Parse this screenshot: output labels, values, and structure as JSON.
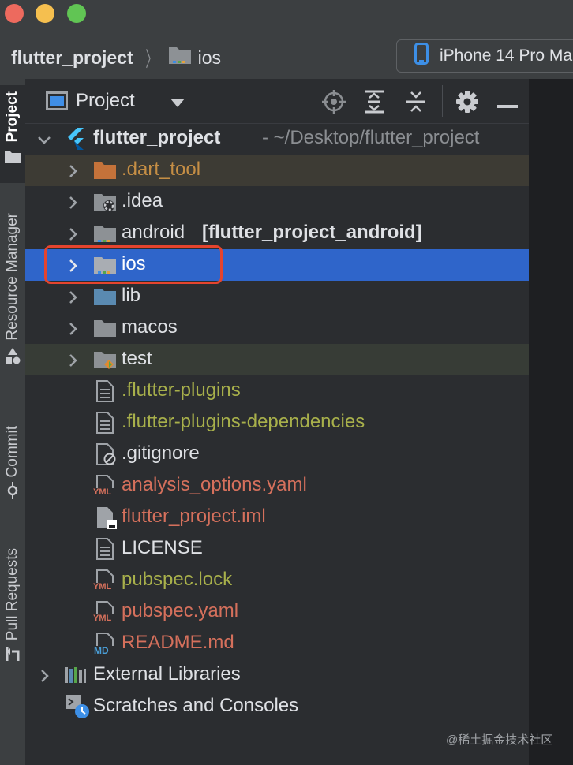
{
  "window": {
    "traffic_lights": [
      "close",
      "minimize",
      "maximize"
    ]
  },
  "breadcrumb": {
    "root": "flutter_project",
    "current": "ios"
  },
  "device_selector": {
    "label": "iPhone 14 Pro Ma"
  },
  "left_stripe": {
    "tabs": [
      {
        "label": "Project",
        "active": true
      },
      {
        "label": "Resource Manager",
        "active": false
      },
      {
        "label": "Commit",
        "active": false
      },
      {
        "label": "Pull Requests",
        "active": false
      }
    ]
  },
  "project_panel": {
    "title": "Project",
    "view_dropdown_icon": "triangle-down-icon",
    "toolbar_icons": [
      "locate-icon",
      "expand-all-icon",
      "collapse-all-icon",
      "gear-icon",
      "hide-icon"
    ]
  },
  "tree": {
    "root": {
      "name": "flutter_project",
      "path": "- ~/Desktop/flutter_project"
    },
    "items": [
      {
        "name": ".dart_tool",
        "type": "folder-orange",
        "color": "#c58e45"
      },
      {
        "name": ".idea",
        "type": "folder-settings",
        "color": "#dfe1e5"
      },
      {
        "name": "android",
        "suffix": "[flutter_project_android]",
        "type": "folder-module",
        "color": "#dfe1e5"
      },
      {
        "name": "ios",
        "type": "folder-module",
        "color": "#ffffff",
        "selected": true
      },
      {
        "name": "lib",
        "type": "folder-source",
        "color": "#dfe1e5"
      },
      {
        "name": "macos",
        "type": "folder",
        "color": "#dfe1e5"
      },
      {
        "name": "test",
        "type": "folder-test",
        "color": "#dfe1e5"
      },
      {
        "name": ".flutter-plugins",
        "type": "file-text",
        "color": "#a8b04b"
      },
      {
        "name": ".flutter-plugins-dependencies",
        "type": "file-text",
        "color": "#a8b04b"
      },
      {
        "name": ".gitignore",
        "type": "file-ignore",
        "color": "#dfe1e5"
      },
      {
        "name": "analysis_options.yaml",
        "type": "file-yaml",
        "color": "#d5705c"
      },
      {
        "name": "flutter_project.iml",
        "type": "file-iml",
        "color": "#d5705c"
      },
      {
        "name": "LICENSE",
        "type": "file-text",
        "color": "#dfe1e5"
      },
      {
        "name": "pubspec.lock",
        "type": "file-yaml",
        "color": "#a8b04b"
      },
      {
        "name": "pubspec.yaml",
        "type": "file-yaml",
        "color": "#d5705c"
      },
      {
        "name": "README.md",
        "type": "file-md",
        "color": "#d5705c"
      }
    ],
    "external_libraries": "External Libraries",
    "scratches": "Scratches and Consoles"
  },
  "icon_badges": {
    "yaml": "YML",
    "markdown": "MD"
  },
  "colors": {
    "selection": "#2f65ca",
    "highlight_box": "#e5442e",
    "flutter_blue": "#47c5fb"
  },
  "watermark": "@稀土掘金技术社区"
}
